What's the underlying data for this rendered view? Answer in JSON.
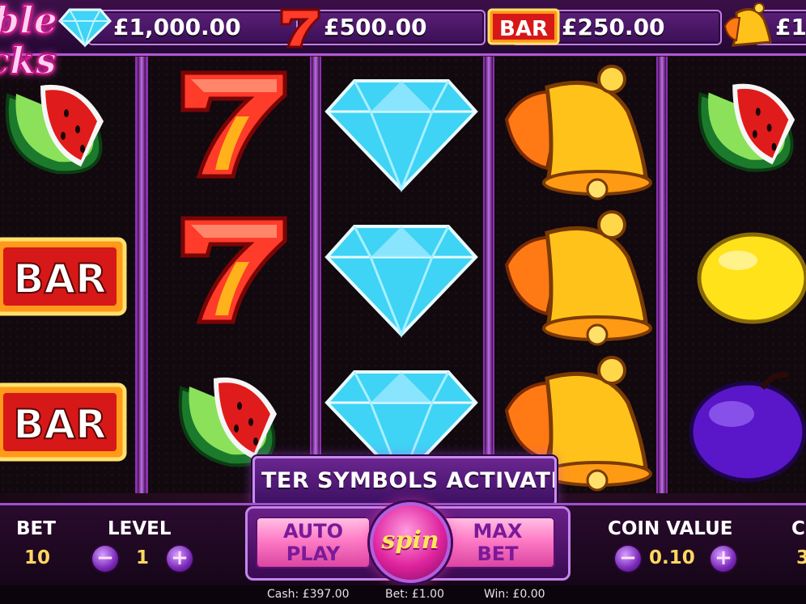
{
  "paytable": [
    {
      "icon": "diamond-icon",
      "value": "£1,000.00"
    },
    {
      "icon": "seven-icon",
      "value": "£500.00"
    },
    {
      "icon": "bar-icon",
      "value": "£250.00",
      "icon_text": "BAR"
    },
    {
      "icon": "bell-icon",
      "value": "£1"
    }
  ],
  "logo": {
    "line1": "ble",
    "line2": "cks"
  },
  "reels": [
    [
      "watermelon",
      "bar",
      "bar"
    ],
    [
      "seven",
      "seven",
      "watermelon"
    ],
    [
      "diamond",
      "diamond",
      "diamond"
    ],
    [
      "bell",
      "bell",
      "bell"
    ],
    [
      "watermelon",
      "lemon",
      "plum"
    ]
  ],
  "symbols": {
    "bar_text": "BAR"
  },
  "banner": {
    "text": "TER SYMBOLS ACTIVATE"
  },
  "controls": {
    "bet_label": "BET",
    "bet_value": "10",
    "level_label": "LEVEL",
    "level_value": "1",
    "minus": "−",
    "plus": "+",
    "auto_play_line1": "AUTO",
    "auto_play_line2": "PLAY",
    "spin_label": "spin",
    "max_bet_line1": "MAX",
    "max_bet_line2": "BET",
    "coin_value_label": "COIN VALUE",
    "coin_value": "0.10",
    "coins_label": "C",
    "coins_value": "3"
  },
  "status": {
    "cash": "Cash: £397.00",
    "bet": "Bet: £1.00",
    "win": "Win: £0.00"
  },
  "colors": {
    "accent": "#c27ee8",
    "value_gold": "#ffd860",
    "spin_pink": "#e0239e"
  }
}
